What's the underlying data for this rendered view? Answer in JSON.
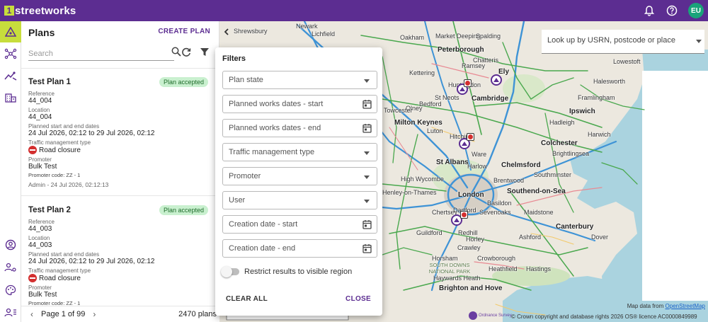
{
  "app": {
    "logo_mark": "1",
    "logo_text": "streetworks"
  },
  "topbar": {
    "icons": [
      "bell-icon",
      "help-icon"
    ],
    "avatar_initials": "EU"
  },
  "rail": {
    "items": [
      "plans-icon",
      "network-icon",
      "analytics-icon",
      "building-icon",
      "account-icon",
      "users-cog-icon",
      "palette-icon",
      "admin-users-icon"
    ]
  },
  "plans": {
    "title": "Plans",
    "create_label": "CREATE PLAN",
    "search_placeholder": "Search",
    "cards": [
      {
        "title": "Test Plan 1",
        "status": "Plan accepted",
        "reference_label": "Reference",
        "reference": "44_004",
        "location_label": "Location",
        "location": "44_004",
        "dates_label": "Planned start and end dates",
        "dates": "24 Jul 2026, 02:12 to 29 Jul 2026, 02:12",
        "tm_label": "Traffic management type",
        "tm": "Road closure",
        "promoter_label": "Promoter",
        "promoter": "Bulk Test",
        "promoter_code": "Promoter code: ZZ - 1",
        "meta": "Admin - 24 Jul 2026, 02:12:13"
      },
      {
        "title": "Test Plan 2",
        "status": "Plan accepted",
        "reference_label": "Reference",
        "reference": "44_003",
        "location_label": "Location",
        "location": "44_003",
        "dates_label": "Planned start and end dates",
        "dates": "24 Jul 2026, 02:12 to 29 Jul 2026, 02:12",
        "tm_label": "Traffic management type",
        "tm": "Road closure",
        "promoter_label": "Promoter",
        "promoter": "Bulk Test",
        "promoter_code": "Promoter code: ZZ - 1"
      }
    ],
    "pager": {
      "page_label": "Page 1 of 99",
      "count": "2470 plans"
    }
  },
  "map": {
    "lookup_placeholder": "Look up by USRN, postcode or place",
    "attribution_prefix": "Map data from ",
    "attribution_link": "OpenStreetMap",
    "copyright": "© Crown copyright and database rights 2026 OS® licence AC0000849989",
    "os_logo": "Ordnance Survey",
    "labels": {
      "newark": "Newark",
      "shrewsbury": "Shrewsbury",
      "lichfield": "Lichfield",
      "oakham": "Oakham",
      "market_deeping": "Market Deeping",
      "spalding": "Spalding",
      "peterborough": "Peterborough",
      "ramsey": "Ramsey",
      "chatteris": "Chatteris",
      "ely": "Ely",
      "kettering": "Kettering",
      "huntingdon": "Huntingdon",
      "st_neots": "St Neots",
      "cambridge": "Cambridge",
      "bedford": "Bedford",
      "olney": "Olney",
      "towcester": "Towcester",
      "milton_keynes": "Milton Keynes",
      "luton": "Luton",
      "hitchin": "Hitchin",
      "ware": "Ware",
      "st_albans": "St Albans",
      "high_wycombe": "High Wycombe",
      "henley": "Henley-on-Thames",
      "london": "London",
      "brentwood": "Brentwood",
      "southend": "Southend-on-Sea",
      "chelmsford": "Chelmsford",
      "colchester": "Colchester",
      "southminster": "Southminster",
      "chertsey": "Chertsey",
      "guildford": "Guildford",
      "redhill": "Redhill",
      "crawley": "Crawley",
      "crowborough": "Crowborough",
      "canterbury": "Canterbury",
      "ashford": "Ashford",
      "brighton": "Brighton and Hove",
      "lowestoft": "Lowestoft",
      "halesworth": "Halesworth",
      "framlingham": "Framlingham",
      "ipswich": "Ipswich",
      "hadleigh": "Hadleigh",
      "brightlingsea": "Brightlingsea",
      "harwich": "Harwich",
      "dover": "Dover",
      "hastings": "Hastings",
      "heathfield": "Heathfield",
      "maidstone": "Maidstone",
      "sevenoaks": "Sevenoaks",
      "horsham": "Horsham",
      "haywards_heath": "Haywards Heath",
      "south_downs": "SOUTH DOWNS NATIONAL PARK",
      "horley": "Horley",
      "dartford": "Dartford",
      "basildon": "Basildon",
      "harlow": "Harlow"
    }
  },
  "filters": {
    "title": "Filters",
    "plan_state": "Plan state",
    "works_start": "Planned works dates - start",
    "works_end": "Planned works dates - end",
    "tm_type": "Traffic management type",
    "promoter": "Promoter",
    "user": "User",
    "creation_start": "Creation date - start",
    "creation_end": "Creation date - end",
    "restrict_label": "Restrict results to visible region",
    "clear_label": "CLEAR ALL",
    "close_label": "CLOSE"
  },
  "colors": {
    "brand": "#5c2d91",
    "accent": "#c7dd3c",
    "status_bg": "#c9f0cf",
    "road_closure": "#d32f2f"
  }
}
